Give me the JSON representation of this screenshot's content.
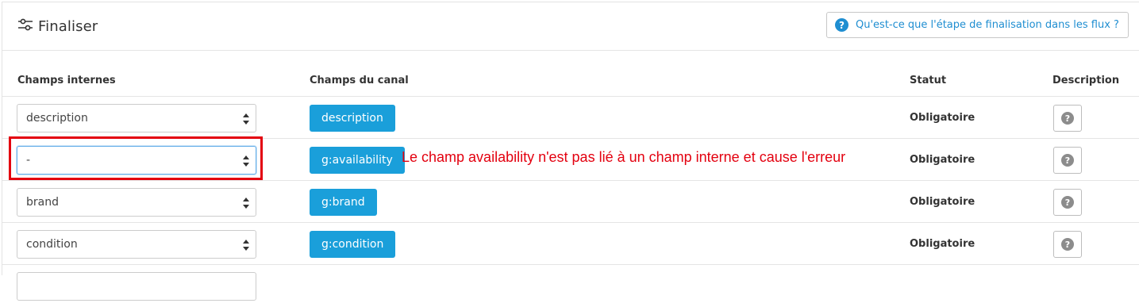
{
  "header": {
    "title": "Finaliser",
    "help_link": "Qu'est-ce que l'étape de finalisation dans les flux ?"
  },
  "columns": {
    "internal": "Champs internes",
    "channel": "Champs du canal",
    "status": "Statut",
    "description": "Description"
  },
  "rows": [
    {
      "internal_value": "description",
      "channel_field": "description",
      "status": "Obligatoire"
    },
    {
      "internal_value": "-",
      "channel_field": "g:availability",
      "status": "Obligatoire"
    },
    {
      "internal_value": "brand",
      "channel_field": "g:brand",
      "status": "Obligatoire"
    },
    {
      "internal_value": "condition",
      "channel_field": "g:condition",
      "status": "Obligatoire"
    }
  ],
  "annotation": "Le champ availability n'est pas lié à un champ interne et cause l'erreur",
  "colors": {
    "tag_blue": "#1a9fda",
    "link_blue": "#1f8ed1",
    "annotation_red": "#e3000f"
  },
  "icons": {
    "header": "sliders-icon",
    "help": "question-circle-icon",
    "select_caret": "sort-caret-icon",
    "description": "question-circle-icon"
  }
}
